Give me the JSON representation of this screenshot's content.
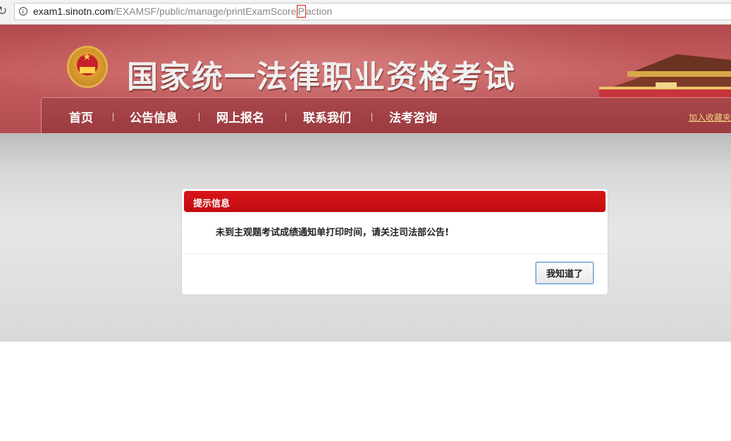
{
  "browser": {
    "url_host": "exam1.sinotn.com",
    "url_path_before_cursor": "/EXAMSF/public/manage/printExamScore",
    "url_cursor_char": "P",
    "url_path_after_cursor": "action"
  },
  "header": {
    "site_title": "国家统一法律职业资格考试"
  },
  "nav": {
    "items": [
      {
        "label": "首页"
      },
      {
        "label": "公告信息"
      },
      {
        "label": "网上报名"
      },
      {
        "label": "联系我们"
      },
      {
        "label": "法考咨询"
      }
    ],
    "bookmark_label": "加入收藏夹"
  },
  "dialog": {
    "title": "提示信息",
    "message": "未到主观题考试成绩通知单打印时间，请关注司法部公告!",
    "ok_label": "我知道了"
  },
  "colors": {
    "header_red": "#b34a4e",
    "nav_red": "#9a3b40",
    "dialog_header_red": "#c10c10",
    "bookmark_gold": "#f1d27a"
  }
}
